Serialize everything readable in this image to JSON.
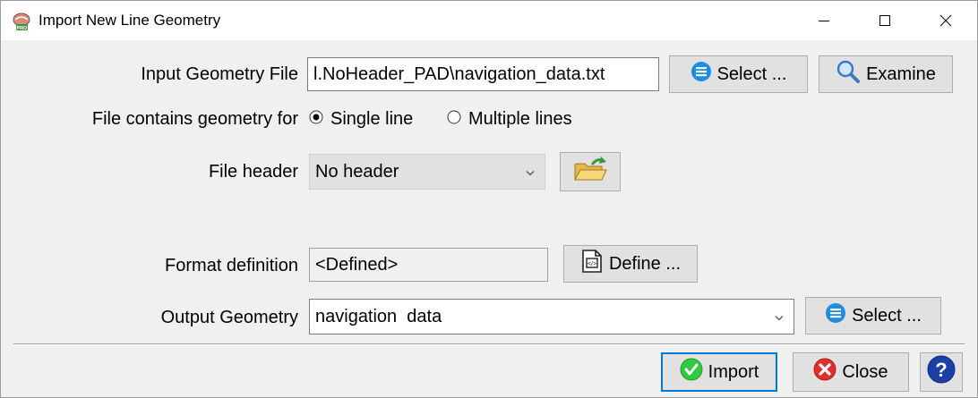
{
  "window": {
    "title": "Import New Line Geometry",
    "controls": {
      "minimize": "—",
      "maximize": "☐",
      "close": "✕"
    }
  },
  "form": {
    "input_file_label": "Input Geometry File",
    "input_file_value": "l.NoHeader_PAD\\navigation_data.txt",
    "select_label": "Select ...",
    "examine_label": "Examine",
    "geometry_for_label": "File contains geometry for",
    "radio_single": "Single line",
    "radio_multiple": "Multiple lines",
    "radio_selected": "single",
    "file_header_label": "File header",
    "file_header_value": "No header",
    "format_label": "Format definition",
    "format_value": "<Defined>",
    "define_label": "Define ...",
    "output_label": "Output Geometry",
    "output_value": "navigation  data",
    "output_select_label": "Select ..."
  },
  "footer": {
    "import_label": "Import",
    "close_label": "Close"
  },
  "colors": {
    "accent": "#0078d7",
    "import_green": "#2ecc40",
    "close_red": "#e0302b",
    "help_blue": "#1a3fa6"
  }
}
